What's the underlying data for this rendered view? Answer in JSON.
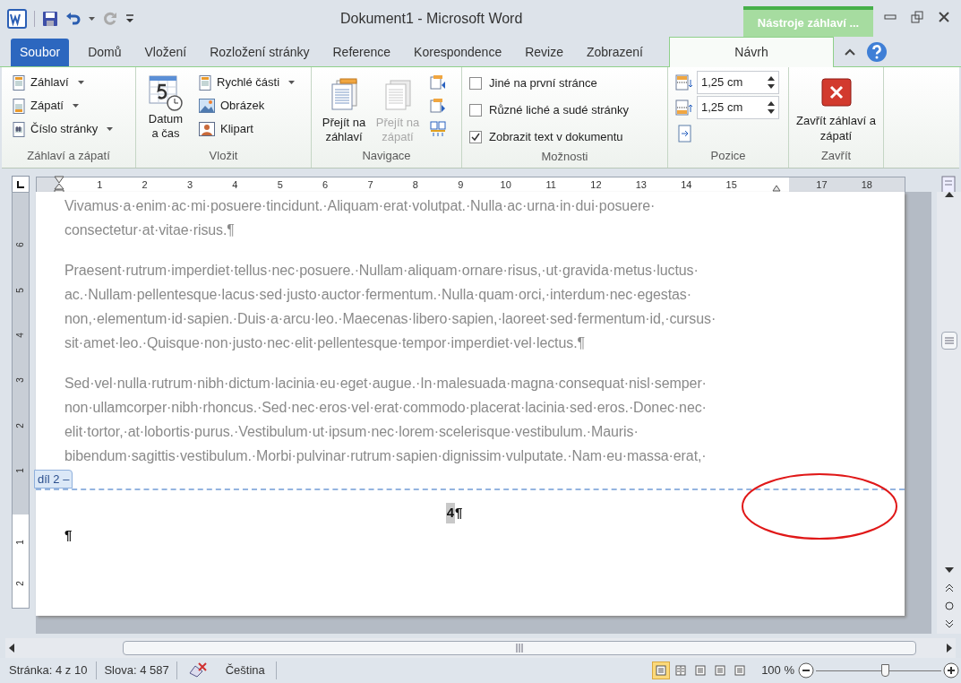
{
  "window": {
    "title": "Dokument1 - Microsoft Word",
    "contextual_header": "Nástroje záhlaví ..."
  },
  "quick_access": [
    {
      "kind": "save",
      "disabled": false
    },
    {
      "kind": "undo",
      "disabled": false
    },
    {
      "kind": "redo",
      "disabled": true
    },
    {
      "kind": "customize",
      "disabled": false
    }
  ],
  "tabs": [
    {
      "label": "Soubor",
      "kind": "file",
      "selected": false
    },
    {
      "label": "Domů",
      "kind": "tab",
      "selected": false
    },
    {
      "label": "Vložení",
      "kind": "tab",
      "selected": false
    },
    {
      "label": "Rozložení stránky",
      "kind": "tab",
      "selected": false
    },
    {
      "label": "Reference",
      "kind": "tab",
      "selected": false
    },
    {
      "label": "Korespondence",
      "kind": "tab",
      "selected": false
    },
    {
      "label": "Revize",
      "kind": "tab",
      "selected": false
    },
    {
      "label": "Zobrazení",
      "kind": "tab",
      "selected": false
    },
    {
      "label": "Návrh",
      "kind": "contextual",
      "selected": true
    }
  ],
  "ribbon": {
    "header_footer": {
      "label": "Záhlaví a zápatí",
      "items": [
        {
          "label": "Záhlaví",
          "dropdown": true
        },
        {
          "label": "Zápatí",
          "dropdown": true
        },
        {
          "label": "Číslo stránky",
          "dropdown": true
        }
      ]
    },
    "insert": {
      "label": "Vložit",
      "large": {
        "label": "Datum a čas"
      },
      "items": [
        {
          "label": "Rychlé části",
          "dropdown": true
        },
        {
          "label": "Obrázek",
          "dropdown": false
        },
        {
          "label": "Klipart",
          "dropdown": false
        }
      ]
    },
    "navigation": {
      "label": "Navigace",
      "large": [
        {
          "label": "Přejít na záhlaví",
          "disabled": false
        },
        {
          "label": "Přejít na zápatí",
          "disabled": true
        }
      ]
    },
    "options": {
      "label": "Možnosti",
      "checkboxes": [
        {
          "label": "Jiné na první stránce",
          "checked": false
        },
        {
          "label": "Různé liché a sudé stránky",
          "checked": false
        },
        {
          "label": "Zobrazit text v dokumentu",
          "checked": true
        }
      ]
    },
    "position": {
      "label": "Pozice",
      "spins": [
        {
          "value": "1,25 cm"
        },
        {
          "value": "1,25 cm"
        }
      ]
    },
    "close": {
      "label": "Zavřít",
      "large": {
        "label": "Zavřít záhlaví a zápatí"
      }
    }
  },
  "ruler": {
    "marks": [
      {
        "kind": "number",
        "label": "1"
      },
      {
        "kind": "number",
        "label": "2"
      },
      {
        "kind": "number",
        "label": "3"
      },
      {
        "kind": "number",
        "label": "4"
      },
      {
        "kind": "number",
        "label": "5"
      },
      {
        "kind": "number",
        "label": "6"
      },
      {
        "kind": "number",
        "label": "7"
      },
      {
        "kind": "number",
        "label": "8"
      },
      {
        "kind": "number",
        "label": "9"
      },
      {
        "kind": "number",
        "label": "10"
      },
      {
        "kind": "number",
        "label": "11"
      },
      {
        "kind": "number",
        "label": "12"
      },
      {
        "kind": "number",
        "label": "13"
      },
      {
        "kind": "number",
        "label": "14"
      },
      {
        "kind": "number",
        "label": "15"
      },
      {
        "kind": "indent"
      },
      {
        "kind": "number",
        "label": "17"
      },
      {
        "kind": "number",
        "label": "18"
      }
    ],
    "vertical_body": [
      "6",
      "5",
      "4",
      "3",
      "2",
      "1"
    ],
    "vertical_footer": [
      "1",
      "2"
    ]
  },
  "document": {
    "paragraphs": [
      {
        "lines": [
          "Vivamus·a·enim·ac·mi·posuere·tincidunt.·Aliquam·erat·volutpat.·Nulla·ac·urna·in·dui·posuere·",
          "consectetur·at·vitae·risus.¶"
        ]
      },
      {
        "lines": [
          "Praesent·rutrum·imperdiet·tellus·nec·posuere.·Nullam·aliquam·ornare·risus,·ut·gravida·metus·luctus·",
          "ac.·Nullam·pellentesque·lacus·sed·justo·auctor·fermentum.·Nulla·quam·orci,·interdum·nec·egestas·",
          "non,·elementum·id·sapien.·Duis·a·arcu·leo.·Maecenas·libero·sapien,·laoreet·sed·fermentum·id,·cursus·",
          "sit·amet·leo.·Quisque·non·justo·nec·elit·pellentesque·tempor·imperdiet·vel·lectus.¶"
        ]
      },
      {
        "lines": [
          "Sed·vel·nulla·rutrum·nibh·dictum·lacinia·eu·eget·augue.·In·malesuada·magna·consequat·nisl·semper·",
          "non·ullamcorper·nibh·rhoncus.·Sed·nec·eros·vel·erat·commodo·placerat·lacinia·sed·eros.·Donec·nec·",
          "elit·tortor,·at·lobortis·purus.·Vestibulum·ut·ipsum·nec·lorem·scelerisque·vestibulum.·Mauris·",
          "bibendum·sagittis·vestibulum.·Morbi·pulvinar·rutrum·sapien·dignissim·vulputate.·Nam·eu·massa·erat,·"
        ]
      }
    ],
    "section_tag": "díl 2 –",
    "footer": {
      "field": "4",
      "mark": "¶",
      "empty_paragraph": "¶"
    }
  },
  "status_bar": {
    "page": "Stránka: 4 z 10",
    "words": "Slova: 4 587",
    "language": "Čeština",
    "views": [
      {
        "selected": true
      },
      {
        "selected": false
      },
      {
        "selected": false
      },
      {
        "selected": false
      },
      {
        "selected": false
      }
    ],
    "zoom": "100 %",
    "zoom_slider": {
      "level": 0.55
    }
  }
}
